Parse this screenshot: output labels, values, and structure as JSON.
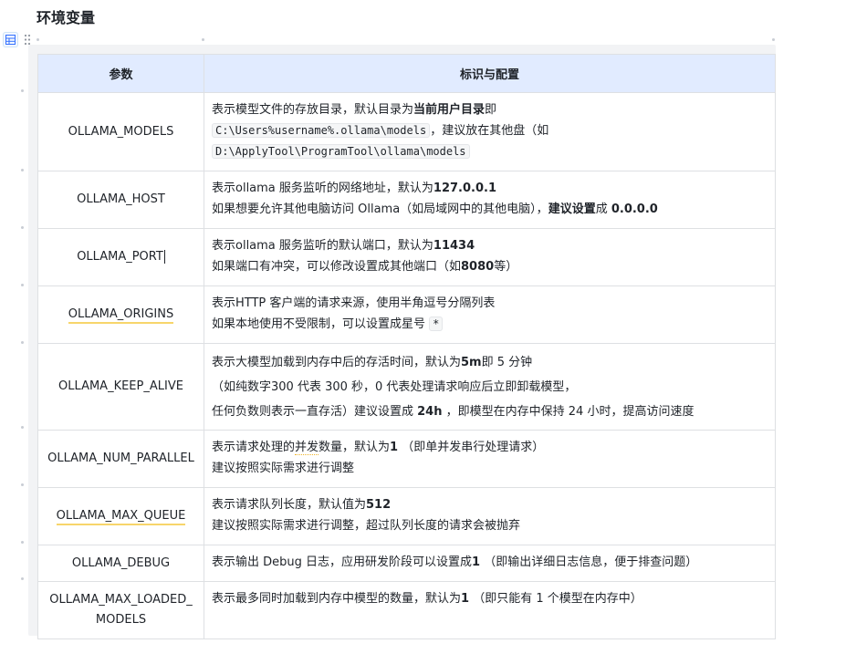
{
  "page": {
    "heading": "环境变量"
  },
  "toolbar": {
    "table_icon": "table-icon",
    "drag_icon": "drag-handle-icon"
  },
  "table": {
    "headers": {
      "param": "参数",
      "config": "标识与配置"
    },
    "header_bg": "#e1ebff",
    "rows": [
      {
        "param": "OLLAMA_MODELS",
        "lines": [
          [
            {
              "t": "表示模型文件的存放目录，默认目录为"
            },
            {
              "t": "当前用户目录",
              "b": true
            },
            {
              "t": "即"
            }
          ],
          [
            {
              "t": "C:\\Users%username%.ollama\\models",
              "code": true
            },
            {
              "t": "，建议放在其他盘（如"
            }
          ],
          [
            {
              "t": "D:\\ApplyTool\\ProgramTool\\ollama\\models",
              "code": true
            }
          ]
        ]
      },
      {
        "param": "OLLAMA_HOST",
        "lines": [
          [
            {
              "t": "表示ollama 服务监听的网络地址，默认为"
            },
            {
              "t": "127.0.0.1",
              "b": true
            }
          ],
          [
            {
              "t": "如果想要允许其他电脑访问 Ollama（如局域网中的其他电脑），"
            },
            {
              "t": "建议设置",
              "b": true
            },
            {
              "t": "成 "
            },
            {
              "t": "0.0.0.0",
              "b": true
            }
          ]
        ]
      },
      {
        "param": "OLLAMA_PORT",
        "caret": true,
        "lines": [
          [
            {
              "t": "表示ollama 服务监听的默认端口，默认为"
            },
            {
              "t": "11434",
              "b": true
            }
          ],
          [
            {
              "t": "如果端口有冲突，可以修改设置成其他端口（如"
            },
            {
              "t": "8080",
              "b": true
            },
            {
              "t": "等）"
            }
          ]
        ]
      },
      {
        "param": "OLLAMA_ORIGINS",
        "underline": "yellow",
        "lines": [
          [
            {
              "t": "表示HTTP 客户端的请求来源，使用半角逗号分隔列表"
            }
          ],
          [
            {
              "t": "如果本地使用不受限制，可以设置成星号 "
            },
            {
              "t": "*",
              "code": true
            }
          ]
        ]
      },
      {
        "param": "OLLAMA_KEEP_ALIVE",
        "tall": true,
        "lines": [
          [
            {
              "t": "表示大模型加载到内存中后的存活时间，默认为"
            },
            {
              "t": "5m",
              "b": true
            },
            {
              "t": "即 5 分钟"
            }
          ],
          [
            {
              "t": "（如纯数字300 代表 300 秒，0 代表处理请求响应后立即卸载模型，"
            }
          ],
          [
            {
              "t": "任何负数则表示一直存活）建议设置成 "
            },
            {
              "t": "24h",
              "b": true
            },
            {
              "t": " ，即模型在内存中保持 24 小时，提高访问速度"
            }
          ]
        ]
      },
      {
        "param": "OLLAMA_NUM_PARALLEL",
        "lines": [
          [
            {
              "t": "表示请求处理的"
            },
            {
              "t": "并发",
              "dotted": true
            },
            {
              "t": "数量，默认为"
            },
            {
              "t": "1",
              "b": true
            },
            {
              "t": " （即单并发串行处理请求）"
            }
          ],
          [
            {
              "t": "建议按照实际需求进行调整"
            }
          ]
        ]
      },
      {
        "param": "OLLAMA_MAX_QUEUE",
        "underline": "yellow",
        "lines": [
          [
            {
              "t": "表示请求队列长度，默认值为"
            },
            {
              "t": "512",
              "b": true
            }
          ],
          [
            {
              "t": "建议按照实际需求进行调整，超过队列长度的请求会被抛弃"
            }
          ]
        ]
      },
      {
        "param": "OLLAMA_DEBUG",
        "lines": [
          [
            {
              "t": "表示输出 Debug 日志，应用研发阶段可以设置成"
            },
            {
              "t": "1",
              "b": true
            },
            {
              "t": " （即输出详细日志信息，便于排查问题）"
            }
          ]
        ]
      },
      {
        "param": "OLLAMA_MAX_LOADED_MODELS",
        "param_lines": [
          "OLLAMA_MAX_LOADED_",
          "MODELS"
        ],
        "lines": [
          [
            {
              "t": "表示最多同时加载到内存中模型的数量，默认为"
            },
            {
              "t": "1",
              "b": true
            },
            {
              "t": " （即只能有 1 个模型在内存中）"
            }
          ]
        ]
      }
    ]
  }
}
